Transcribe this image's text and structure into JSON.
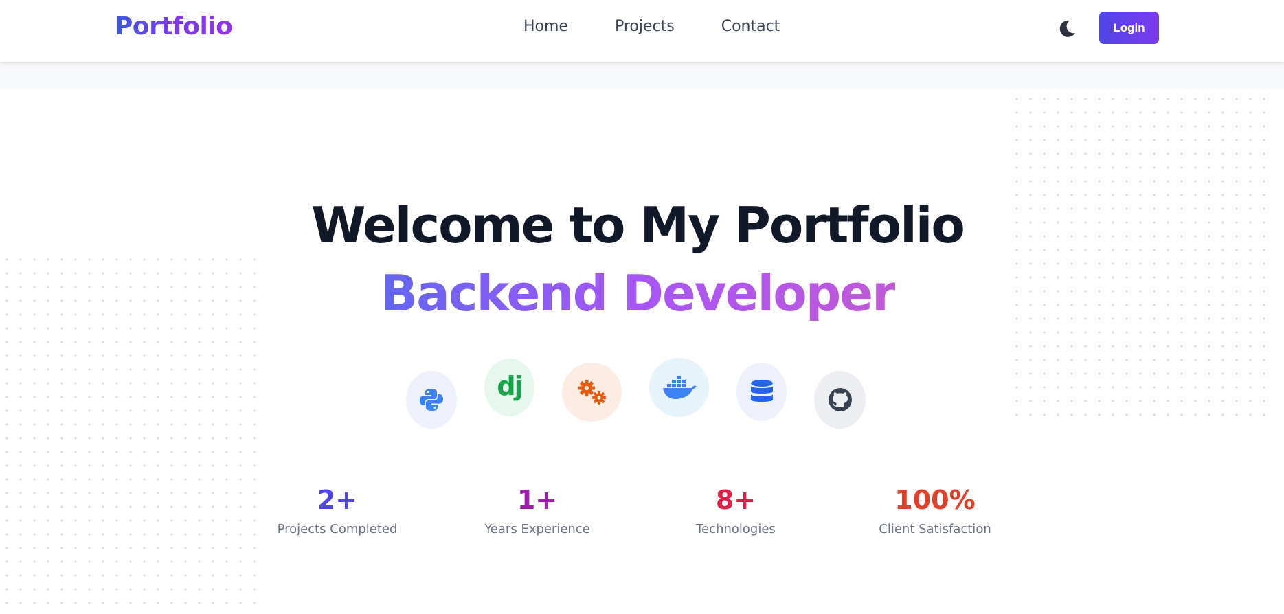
{
  "navbar": {
    "brand": "Portfolio",
    "links": [
      "Home",
      "Projects",
      "Contact"
    ],
    "theme_toggle_icon": "moon-icon",
    "login_label": "Login"
  },
  "hero": {
    "title": "Welcome to My Portfolio",
    "subtitle": "Backend Developer"
  },
  "tech_icons": [
    {
      "name": "python-icon",
      "bg": "#eef0fb"
    },
    {
      "name": "django-icon",
      "text": "dj",
      "bg": "#e8f7ee"
    },
    {
      "name": "gears-icon",
      "bg": "#fdece4"
    },
    {
      "name": "docker-icon",
      "bg": "#e6f3fb"
    },
    {
      "name": "database-icon",
      "bg": "#eef0fb"
    },
    {
      "name": "github-icon",
      "bg": "#eceef1"
    }
  ],
  "stats": [
    {
      "value": "2+",
      "label": "Projects Completed",
      "color": "#4f46e5"
    },
    {
      "value": "1+",
      "label": "Years Experience",
      "color": "#a21caf"
    },
    {
      "value": "8+",
      "label": "Technologies",
      "color": "#e11d48"
    },
    {
      "value": "100%",
      "label": "Client Satisfaction",
      "color": "#e0402a"
    }
  ],
  "colors": {
    "brand_gradient_start": "#3b5bdb",
    "brand_gradient_end": "#9333ea",
    "title": "#111827",
    "login_button": "#4f46e5"
  }
}
